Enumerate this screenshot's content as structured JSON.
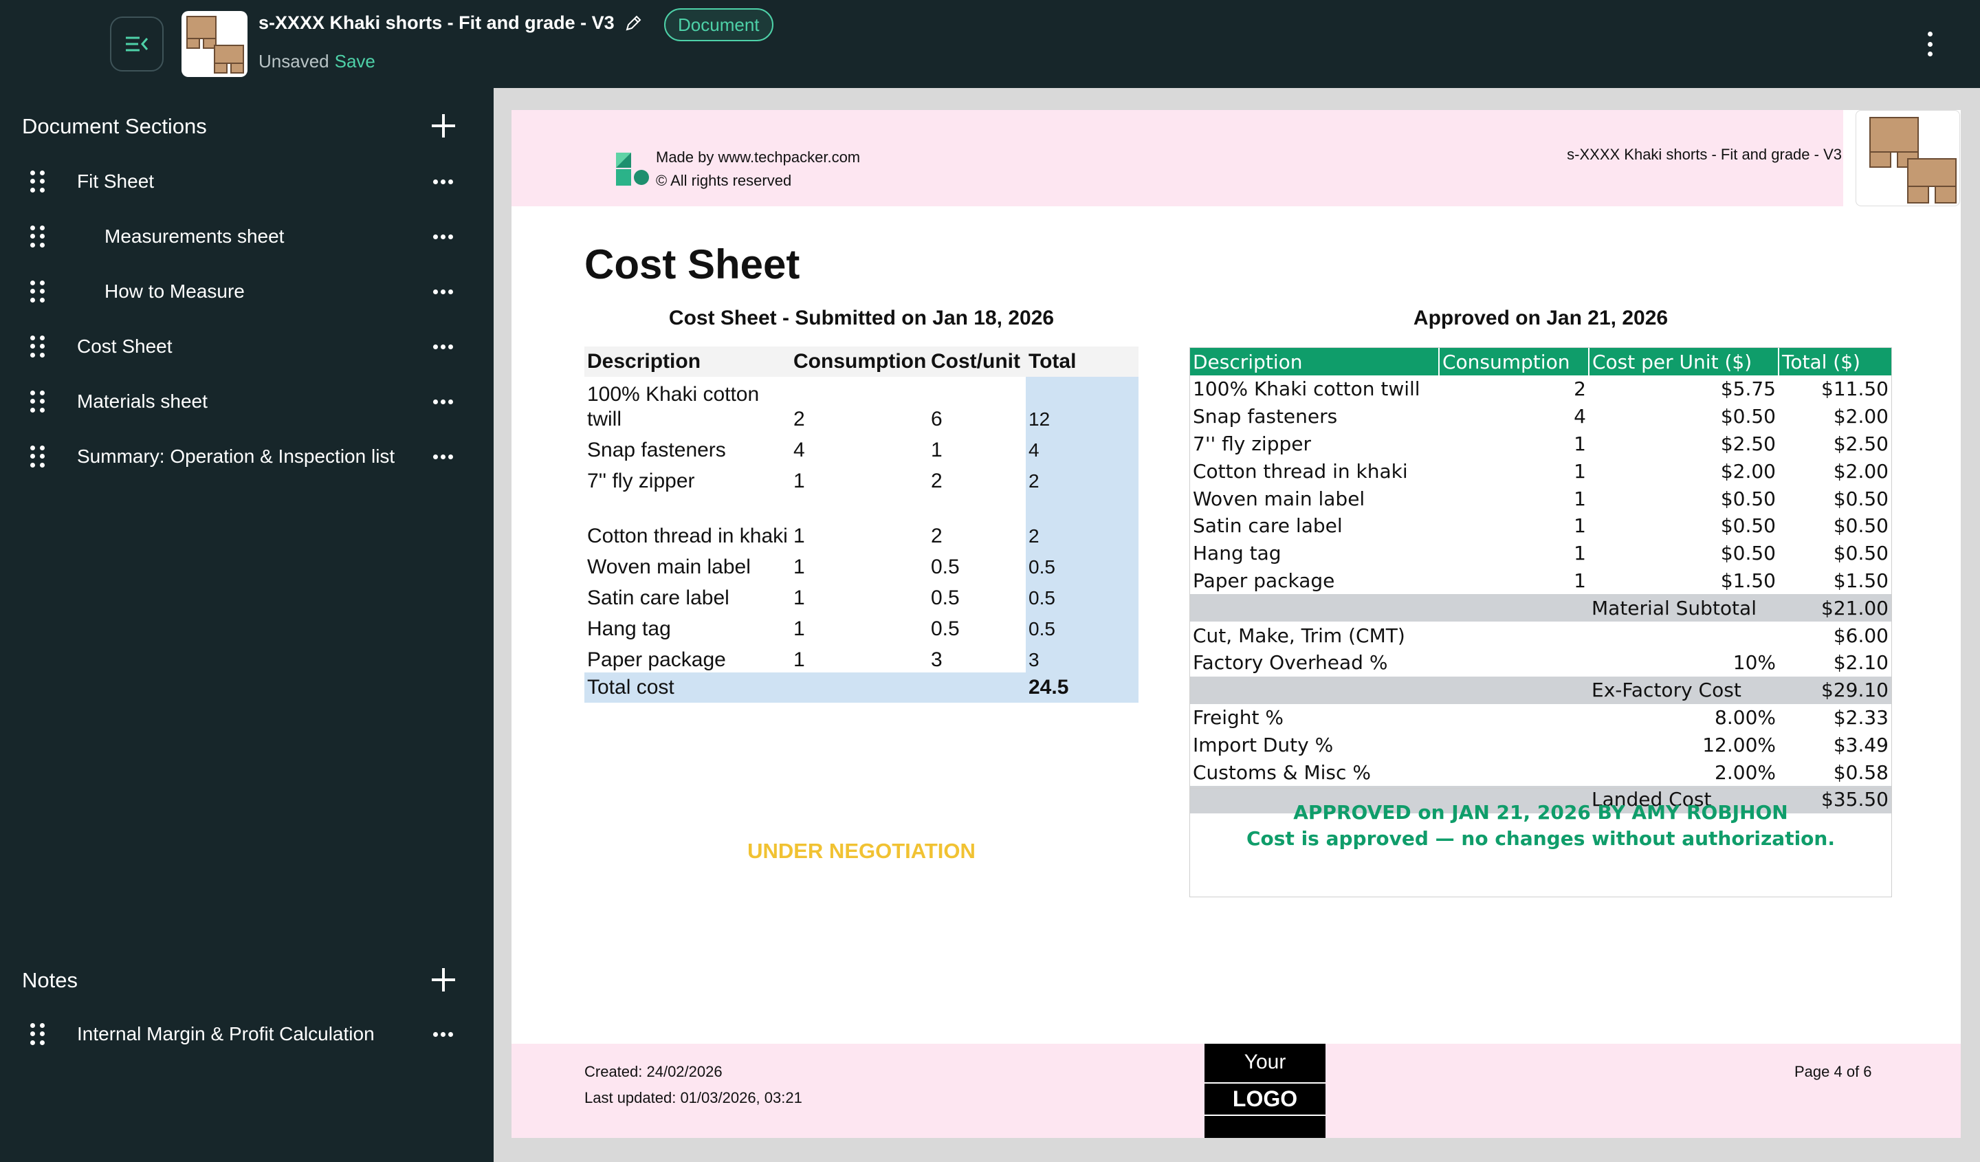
{
  "topbar": {
    "doc_title": "s-XXXX Khaki shorts - Fit and grade - V3",
    "badge": "Document",
    "status": "Unsaved",
    "save_link": "Save"
  },
  "sidebar": {
    "sections_title": "Document Sections",
    "items": [
      {
        "label": "Fit Sheet"
      },
      {
        "label": "Measurements sheet"
      },
      {
        "label": "How to Measure"
      },
      {
        "label": "Cost Sheet"
      },
      {
        "label": "Materials sheet"
      },
      {
        "label": "Summary: Operation & Inspection list"
      }
    ],
    "notes_title": "Notes",
    "notes": [
      {
        "label": "Internal Margin & Profit Calculation"
      }
    ]
  },
  "page": {
    "header": {
      "made_by": "Made by www.techpacker.com",
      "rights": "© All rights reserved",
      "title": "s-XXXX Khaki shorts - Fit and grade - V3"
    },
    "title": "Cost Sheet",
    "left": {
      "subtitle": "Cost Sheet - Submitted on Jan 18, 2026",
      "headers": [
        "Description",
        "Consumption",
        "Cost/unit",
        "Total"
      ],
      "rows": [
        {
          "desc": "100% Khaki cotton twill",
          "cons": "2",
          "cost": "6",
          "total": "12"
        },
        {
          "desc": "Snap fasteners",
          "cons": "4",
          "cost": "1",
          "total": "4"
        },
        {
          "desc": "7'' fly zipper",
          "cons": "1",
          "cost": "2",
          "total": "2"
        },
        {
          "desc": "Cotton thread in khaki",
          "cons": "1",
          "cost": "2",
          "total": "2"
        },
        {
          "desc": "Woven main label",
          "cons": "1",
          "cost": "0.5",
          "total": "0.5"
        },
        {
          "desc": "Satin care label",
          "cons": "1",
          "cost": "0.5",
          "total": "0.5"
        },
        {
          "desc": "Hang tag",
          "cons": "1",
          "cost": "0.5",
          "total": "0.5"
        },
        {
          "desc": "Paper package",
          "cons": "1",
          "cost": "3",
          "total": "3"
        }
      ],
      "total_label": "Total cost",
      "total_value": "24.5",
      "status": "UNDER NEGOTIATION"
    },
    "right": {
      "subtitle": "Approved on Jan 21, 2026",
      "headers": [
        "Description",
        "Consumption",
        "Cost per Unit ($)",
        "Total ($)"
      ],
      "rows": [
        {
          "desc": "100% Khaki cotton twill",
          "cons": "2",
          "cost": "$5.75",
          "total": "$11.50"
        },
        {
          "desc": "Snap fasteners",
          "cons": "4",
          "cost": "$0.50",
          "total": "$2.00"
        },
        {
          "desc": "7'' fly zipper",
          "cons": "1",
          "cost": "$2.50",
          "total": "$2.50"
        },
        {
          "desc": "Cotton thread in khaki",
          "cons": "1",
          "cost": "$2.00",
          "total": "$2.00"
        },
        {
          "desc": "Woven main label",
          "cons": "1",
          "cost": "$0.50",
          "total": "$0.50"
        },
        {
          "desc": "Satin care label",
          "cons": "1",
          "cost": "$0.50",
          "total": "$0.50"
        },
        {
          "desc": "Hang tag",
          "cons": "1",
          "cost": "$0.50",
          "total": "$0.50"
        },
        {
          "desc": "Paper package",
          "cons": "1",
          "cost": "$1.50",
          "total": "$1.50"
        }
      ],
      "material_subtotal": {
        "label": "Material Subtotal",
        "value": "$21.00"
      },
      "cmt": {
        "label": "Cut, Make, Trim (CMT)",
        "value": "$6.00"
      },
      "overhead": {
        "label": "Factory Overhead %",
        "pct": "10%",
        "value": "$2.10"
      },
      "ex_factory": {
        "label": "Ex-Factory Cost",
        "value": "$29.10"
      },
      "freight": {
        "label": "Freight %",
        "pct": "8.00%",
        "value": "$2.33"
      },
      "import_duty": {
        "label": "Import Duty %",
        "pct": "12.00%",
        "value": "$3.49"
      },
      "customs": {
        "label": "Customs & Misc %",
        "pct": "2.00%",
        "value": "$0.58"
      },
      "landed": {
        "label": "Landed Cost",
        "value": "$35.50"
      },
      "approved_line1": "APPROVED on JAN 21, 2026 BY AMY ROBJHON",
      "approved_line2": "Cost is approved — no changes without authorization."
    },
    "footer": {
      "created": "Created: 24/02/2026",
      "updated": "Last updated: 01/03/2026, 03:21",
      "logo_line1": "Your",
      "logo_line2": "LOGO",
      "page": "Page 4 of 6"
    }
  },
  "colors": {
    "sidebar_bg": "#17262a",
    "accent": "#4ed1a8",
    "approved_green": "#0f9d6a",
    "negotiation_yellow": "#f1c232",
    "header_pink": "#fde6f1",
    "total_blue": "#cfe2f3"
  }
}
